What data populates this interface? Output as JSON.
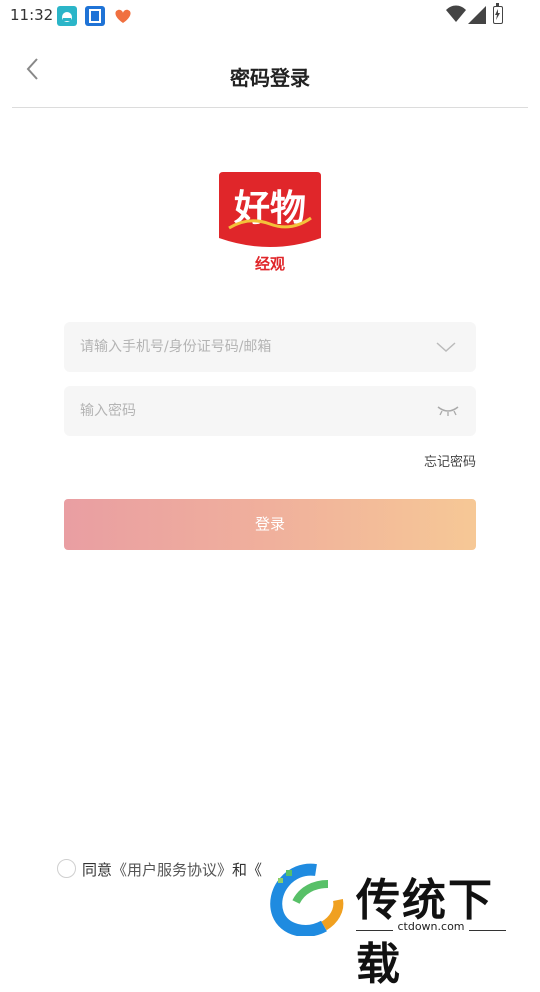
{
  "status_bar": {
    "time": "11:32"
  },
  "header": {
    "title": "密码登录"
  },
  "logo": {
    "main_text": "好物",
    "sub_text": "经观",
    "brand_color": "#e0262a"
  },
  "form": {
    "account_placeholder": "请输入手机号/身份证号码/邮箱",
    "account_value": "",
    "password_placeholder": "输入密码",
    "password_value": "",
    "forgot_label": "忘记密码",
    "login_label": "登录"
  },
  "agreement": {
    "prefix": "同意",
    "service_link": "《用户服务协议》",
    "conjunction": "和《",
    "checked": false
  },
  "watermark": {
    "title": "传统下载",
    "url": "ctdown.com"
  },
  "colors": {
    "login_gradient_start": "#e99ea2",
    "login_gradient_end": "#f6c896",
    "input_background": "#f6f6f6"
  }
}
